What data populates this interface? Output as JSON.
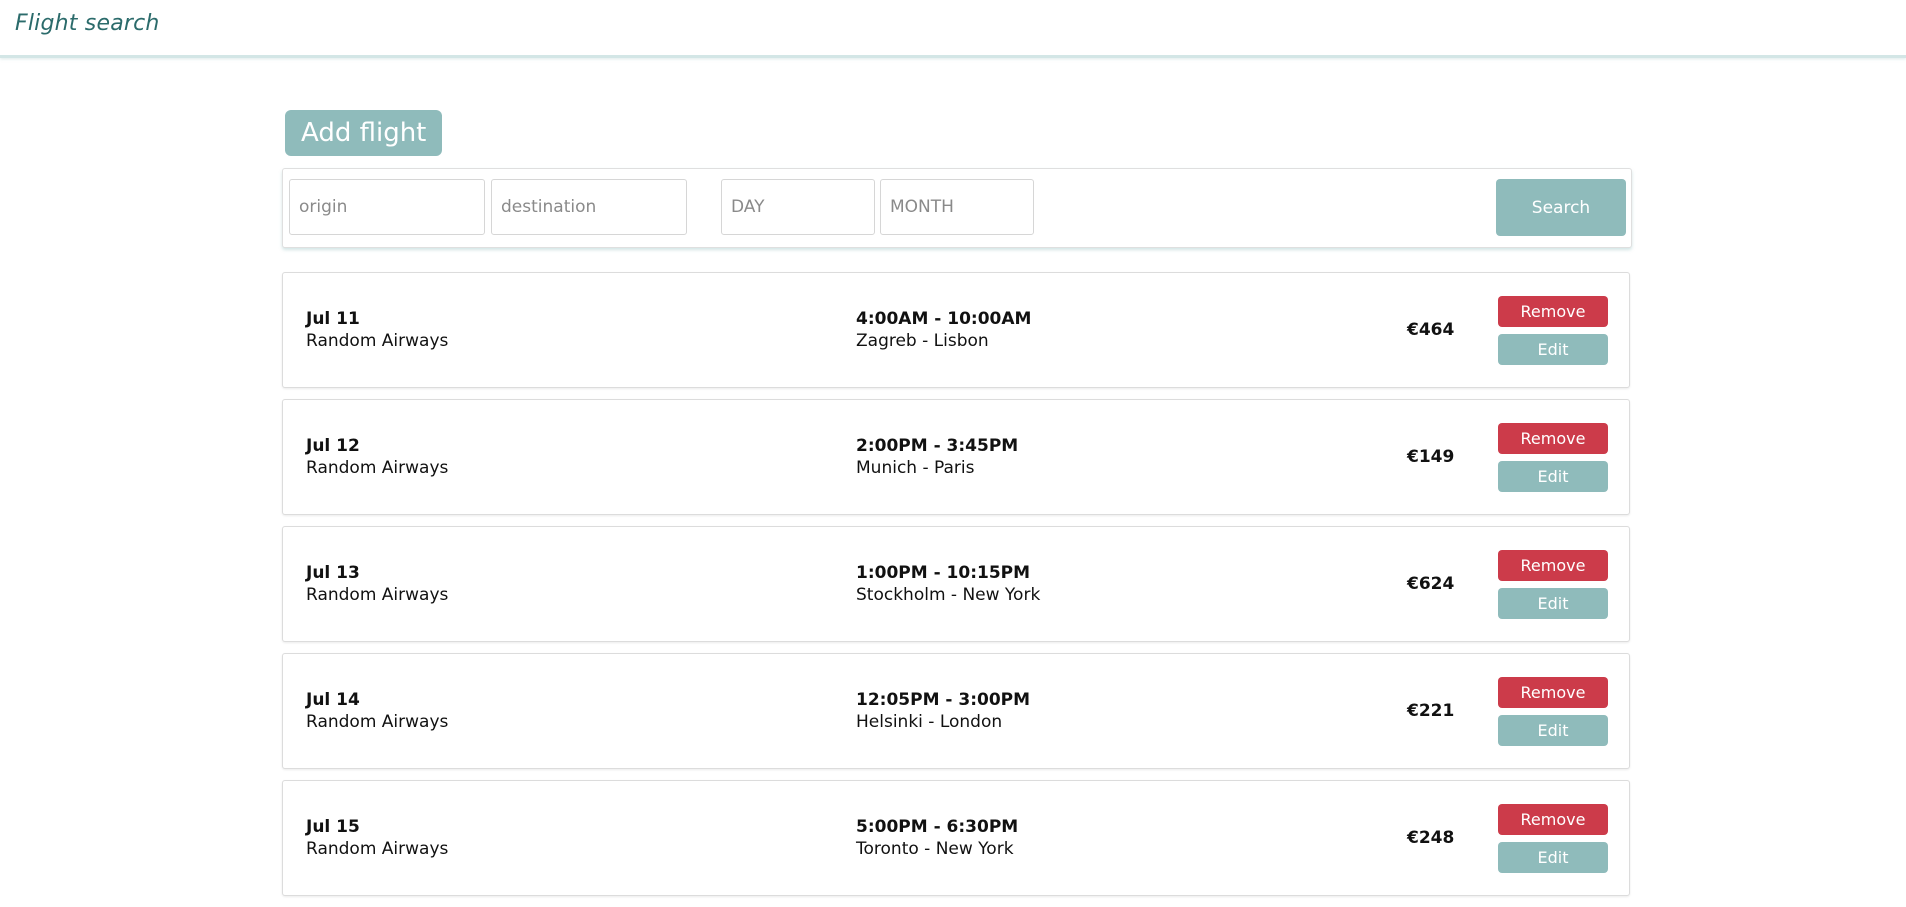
{
  "header": {
    "title": "Flight search"
  },
  "toolbar": {
    "add_label": "Add flight"
  },
  "search": {
    "origin_placeholder": "origin",
    "destination_placeholder": "destination",
    "day_placeholder": "DAY",
    "month_placeholder": "MONTH",
    "button_label": "Search"
  },
  "actions": {
    "remove_label": "Remove",
    "edit_label": "Edit"
  },
  "flights": [
    {
      "date": "Jul 11",
      "airline": "Random Airways",
      "time": "4:00AM - 10:00AM",
      "route": "Zagreb - Lisbon",
      "price": "€464"
    },
    {
      "date": "Jul 12",
      "airline": "Random Airways",
      "time": "2:00PM - 3:45PM",
      "route": "Munich - Paris",
      "price": "€149"
    },
    {
      "date": "Jul 13",
      "airline": "Random Airways",
      "time": "1:00PM - 10:15PM",
      "route": "Stockholm - New York",
      "price": "€624"
    },
    {
      "date": "Jul 14",
      "airline": "Random Airways",
      "time": "12:05PM - 3:00PM",
      "route": "Helsinki - London",
      "price": "€221"
    },
    {
      "date": "Jul 15",
      "airline": "Random Airways",
      "time": "5:00PM - 6:30PM",
      "route": "Toronto - New York",
      "price": "€248"
    }
  ],
  "colors": {
    "accent": "#8fbbbb",
    "danger": "#cc3b4a",
    "brand_text": "#2b6b6b"
  }
}
